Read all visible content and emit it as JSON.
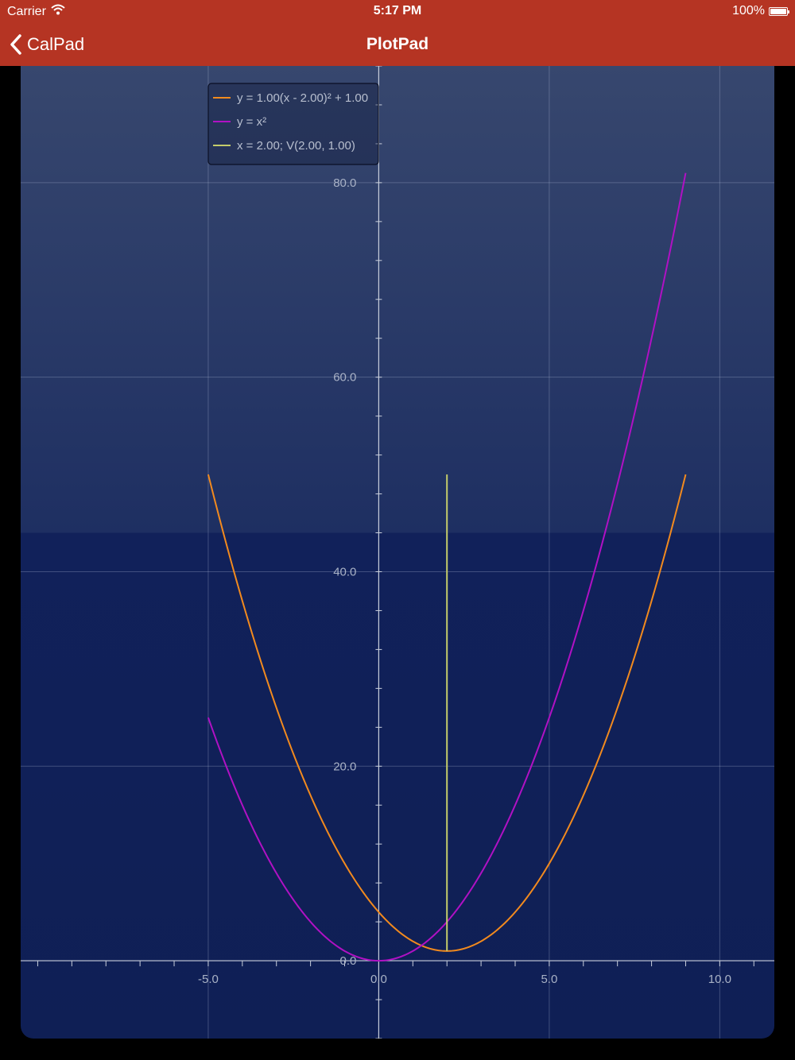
{
  "status_bar": {
    "carrier": "Carrier",
    "time": "5:17 PM",
    "battery": "100%",
    "battery_level": 1.0
  },
  "nav_bar": {
    "back_label": "CalPad",
    "title": "PlotPad",
    "color": "#b53423"
  },
  "chart_data": {
    "type": "line",
    "title": "",
    "xlabel": "",
    "ylabel": "",
    "xlim": [
      -10.5,
      11.6
    ],
    "ylim": [
      -8,
      92
    ],
    "grid": true,
    "legend_position": "top-left",
    "x_ticks": [
      -5,
      0,
      5,
      10
    ],
    "x_tick_labels": [
      "-5.0",
      "0.0",
      "5.0",
      "10.0"
    ],
    "y_ticks": [
      0,
      20,
      40,
      60,
      80
    ],
    "y_tick_labels": [
      "0.0",
      "20.0",
      "40.0",
      "60.0",
      "80.0"
    ],
    "series": [
      {
        "name": "y = 1.00(x - 2.00)² + 1.00",
        "color": "#f28a1e",
        "kind": "parabola",
        "a": 1,
        "h": 2,
        "k": 1,
        "x_range": [
          -5,
          9
        ]
      },
      {
        "name": "y = x²",
        "color": "#b011c4",
        "kind": "parabola",
        "a": 1,
        "h": 0,
        "k": 0,
        "x_range": [
          -5,
          9
        ]
      },
      {
        "name": "x = 2.00; V(2.00, 1.00)",
        "color": "#c4cc6a",
        "kind": "vertical",
        "x": 2,
        "y_range": [
          1,
          50
        ]
      }
    ]
  }
}
